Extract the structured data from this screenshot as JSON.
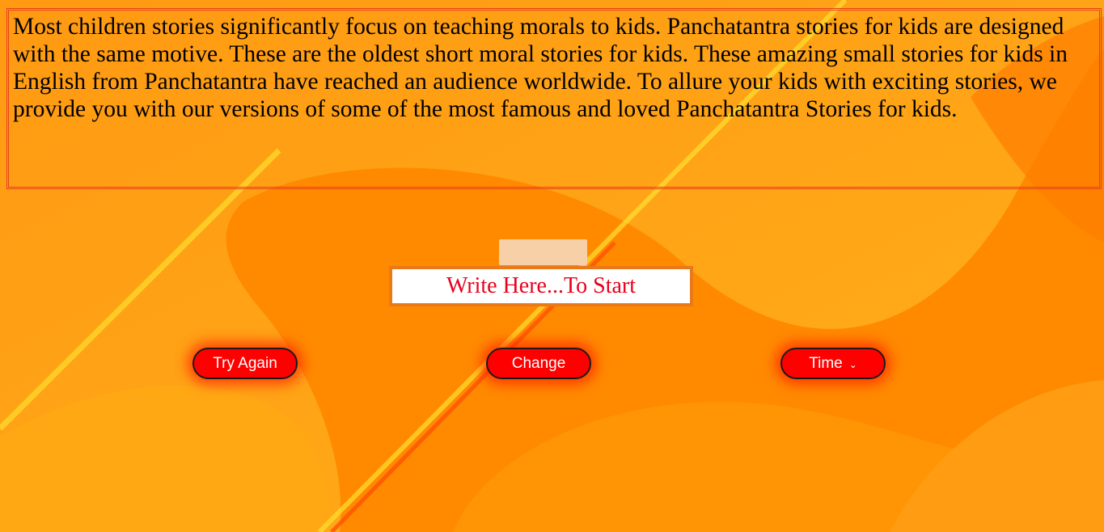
{
  "story": {
    "text": "Most children stories significantly focus on teaching morals to kids. Panchatantra stories for kids are designed with the same motive. These are the oldest short moral stories for kids. These amazing small stories for kids in English from Panchatantra have reached an audience worldwide. To allure your kids with exciting stories, we provide you with our versions of some of the most famous and loved Panchatantra Stories for kids."
  },
  "input": {
    "placeholder": "Write Here...To Start",
    "value": ""
  },
  "buttons": {
    "try_again": "Try Again",
    "change": "Change",
    "time": "Time"
  },
  "icons": {
    "time_dropdown": "chevron-down-icon"
  },
  "colors": {
    "background": "#ff9a10",
    "button": "#ff0000",
    "input_text": "#e8001c",
    "border": "#e8401a"
  }
}
